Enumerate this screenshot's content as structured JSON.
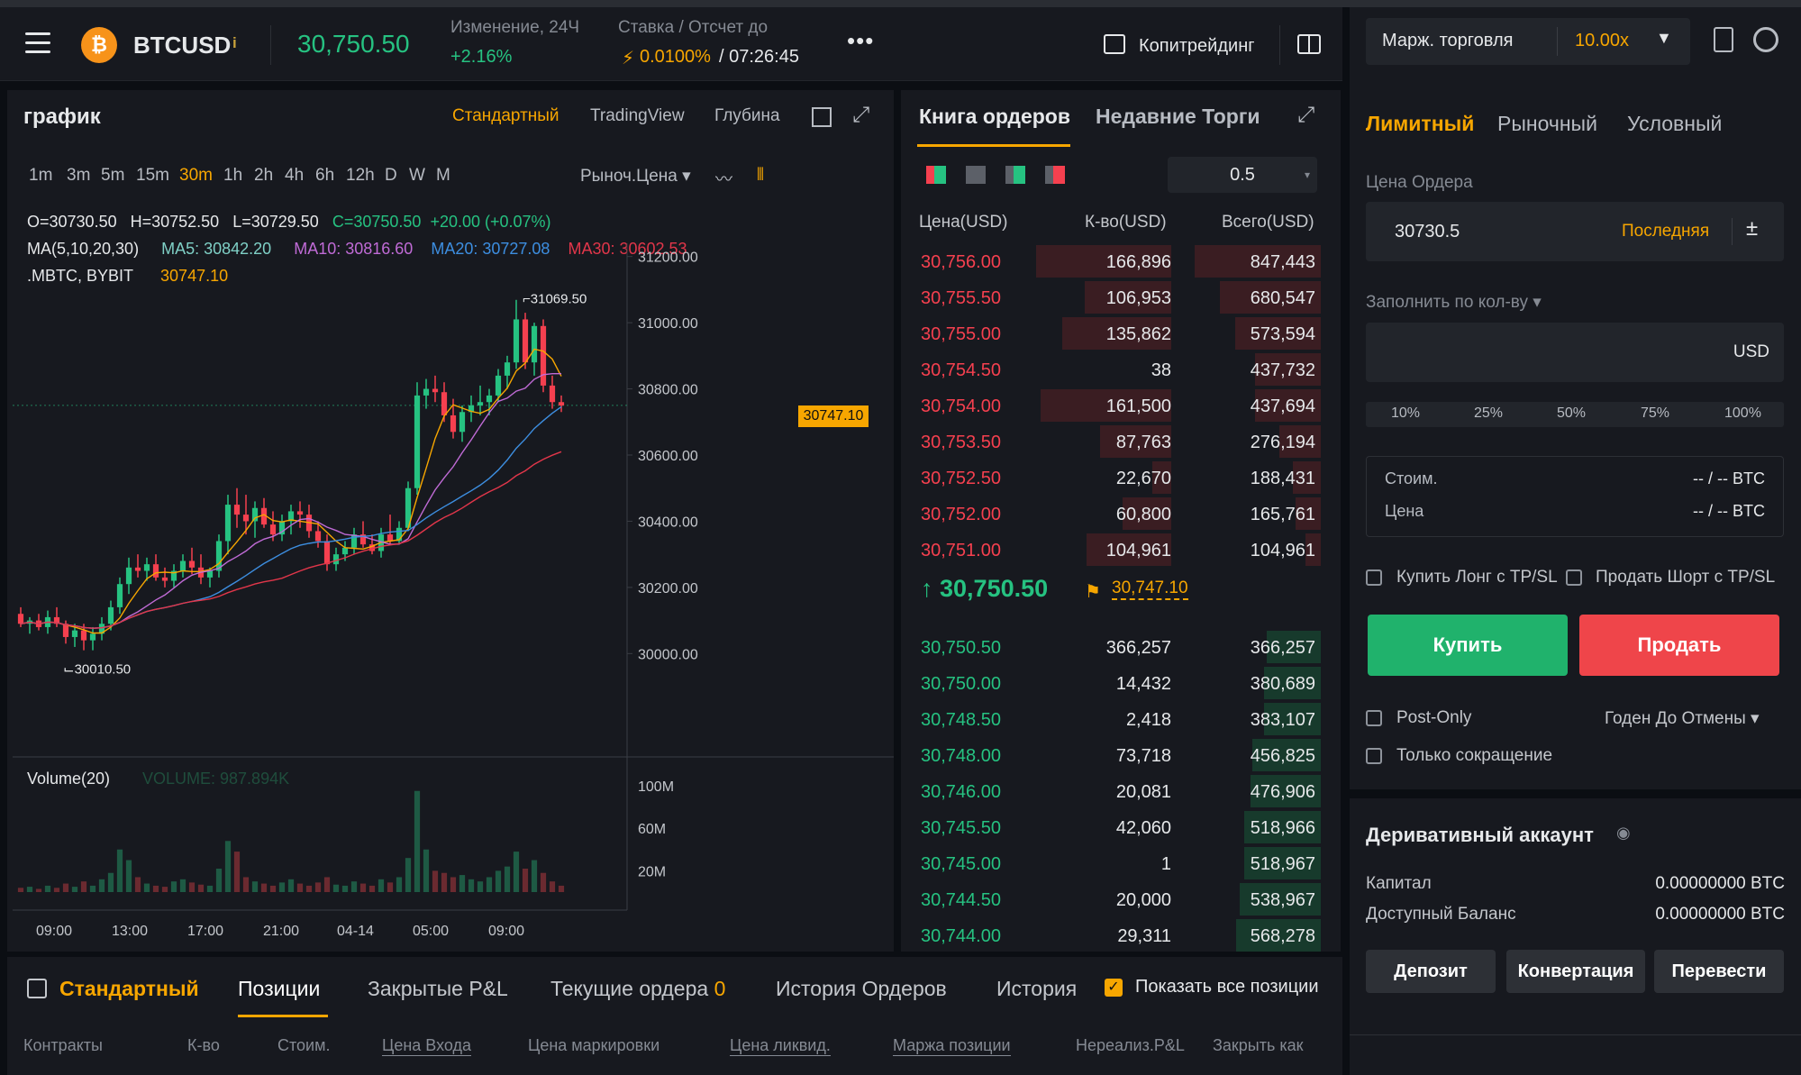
{
  "header": {
    "symbol": "BTCUSD",
    "coin_glyph": "₿",
    "price": "30,750.50",
    "change_label": "Изменение, 24Ч",
    "change_value": "+2.16%",
    "funding_label": "Ставка / Отсчет до",
    "funding_rate": "0.0100%",
    "funding_countdown": "/ 07:26:45",
    "more": "•••",
    "copytrading": "Копитрейдинг"
  },
  "chart": {
    "title": "график",
    "modes": [
      "Стандартный",
      "TradingView",
      "Глубина"
    ],
    "timeframes": [
      "1m",
      "3m",
      "5m",
      "15m",
      "30m",
      "1h",
      "2h",
      "4h",
      "6h",
      "12h",
      "D",
      "W",
      "M"
    ],
    "active_timeframe": "30m",
    "price_type": "Рыноч.Цена ▾",
    "ohlc": {
      "o": "O=30730.50",
      "h": "H=30752.50",
      "l": "L=30729.50",
      "c": "C=30750.50",
      "chg": "+20.00 (+0.07%)"
    },
    "ma": {
      "label": "MA(5,10,20,30)",
      "ma5": "MA5: 30842.20",
      "ma10": "MA10: 30816.60",
      "ma20": "MA20: 30727.08",
      "ma30": "MA30: 30602.53"
    },
    "mark": {
      "label": ".MBTC,  BYBIT",
      "value": "30747.10"
    },
    "high_annot": "31069.50",
    "low_annot": "30010.50",
    "price_tag": "30747.10",
    "volume_label": "Volume(20)",
    "volume_value": "VOLUME: 987.894K",
    "volume_ticks": [
      "100M",
      "60M",
      "20M"
    ],
    "x_ticks": [
      "09:00",
      "13:00",
      "17:00",
      "21:00",
      "04-14",
      "05:00",
      "09:00"
    ]
  },
  "chart_data": {
    "type": "candlestick",
    "y_ticks": [
      31200,
      31000,
      30800,
      30600,
      30400,
      30200,
      30000
    ],
    "ylim": [
      29960,
      31240
    ],
    "candles": [
      [
        30120,
        30140,
        30080,
        30090
      ],
      [
        30090,
        30110,
        30060,
        30100
      ],
      [
        30100,
        30120,
        30070,
        30080
      ],
      [
        30080,
        30130,
        30060,
        30110
      ],
      [
        30110,
        30140,
        30080,
        30090
      ],
      [
        30090,
        30100,
        30030,
        30050
      ],
      [
        30050,
        30090,
        30020,
        30070
      ],
      [
        30070,
        30090,
        30010,
        30040
      ],
      [
        30040,
        30080,
        30010,
        30060
      ],
      [
        30060,
        30110,
        30040,
        30090
      ],
      [
        30090,
        30160,
        30070,
        30140
      ],
      [
        30140,
        30230,
        30120,
        30210
      ],
      [
        30210,
        30290,
        30180,
        30260
      ],
      [
        30260,
        30300,
        30230,
        30250
      ],
      [
        30250,
        30290,
        30220,
        30270
      ],
      [
        30270,
        30300,
        30220,
        30230
      ],
      [
        30230,
        30260,
        30200,
        30220
      ],
      [
        30220,
        30270,
        30200,
        30250
      ],
      [
        30250,
        30300,
        30230,
        30280
      ],
      [
        30280,
        30320,
        30240,
        30260
      ],
      [
        30260,
        30300,
        30210,
        30230
      ],
      [
        30230,
        30260,
        30200,
        30250
      ],
      [
        30250,
        30360,
        30230,
        30340
      ],
      [
        30340,
        30480,
        30300,
        30450
      ],
      [
        30450,
        30500,
        30380,
        30420
      ],
      [
        30420,
        30480,
        30360,
        30400
      ],
      [
        30400,
        30460,
        30350,
        30440
      ],
      [
        30440,
        30470,
        30380,
        30390
      ],
      [
        30390,
        30430,
        30340,
        30360
      ],
      [
        30360,
        30420,
        30340,
        30400
      ],
      [
        30400,
        30450,
        30360,
        30430
      ],
      [
        30430,
        30460,
        30380,
        30420
      ],
      [
        30420,
        30450,
        30350,
        30370
      ],
      [
        30370,
        30400,
        30320,
        30340
      ],
      [
        30340,
        30360,
        30250,
        30270
      ],
      [
        30270,
        30320,
        30250,
        30300
      ],
      [
        30300,
        30340,
        30280,
        30320
      ],
      [
        30320,
        30380,
        30300,
        30360
      ],
      [
        30360,
        30400,
        30320,
        30330
      ],
      [
        30330,
        30360,
        30300,
        30310
      ],
      [
        30310,
        30380,
        30290,
        30360
      ],
      [
        30360,
        30420,
        30330,
        30340
      ],
      [
        30340,
        30400,
        30330,
        30380
      ],
      [
        30380,
        30520,
        30370,
        30500
      ],
      [
        30500,
        30820,
        30480,
        30780
      ],
      [
        30780,
        30830,
        30740,
        30800
      ],
      [
        30800,
        30840,
        30760,
        30790
      ],
      [
        30790,
        30820,
        30700,
        30720
      ],
      [
        30720,
        30770,
        30650,
        30670
      ],
      [
        30670,
        30750,
        30640,
        30730
      ],
      [
        30730,
        30780,
        30700,
        30750
      ],
      [
        30750,
        30810,
        30720,
        30760
      ],
      [
        30760,
        30800,
        30720,
        30780
      ],
      [
        30780,
        30860,
        30760,
        30840
      ],
      [
        30840,
        30900,
        30800,
        30880
      ],
      [
        30880,
        31069,
        30860,
        31010
      ],
      [
        31010,
        31030,
        30860,
        30880
      ],
      [
        30880,
        31000,
        30840,
        30990
      ],
      [
        30990,
        31010,
        30790,
        30810
      ],
      [
        30810,
        30840,
        30740,
        30760
      ],
      [
        30760,
        30780,
        30730,
        30750
      ]
    ],
    "volumes": [
      4,
      5,
      3,
      6,
      4,
      8,
      5,
      10,
      6,
      12,
      18,
      40,
      30,
      14,
      8,
      6,
      5,
      10,
      12,
      9,
      7,
      6,
      22,
      48,
      38,
      14,
      10,
      8,
      6,
      9,
      12,
      8,
      6,
      9,
      14,
      7,
      6,
      10,
      8,
      6,
      12,
      9,
      14,
      32,
      95,
      40,
      20,
      18,
      14,
      16,
      12,
      10,
      14,
      20,
      24,
      38,
      22,
      30,
      18,
      10,
      6
    ],
    "vol_ticks": [
      100,
      60,
      20
    ]
  },
  "orderbook": {
    "tabs": [
      "Книга ордеров",
      "Недавние Торги"
    ],
    "grouping": "0.5",
    "headers": [
      "Цена(USD)",
      "К-во(USD)",
      "Всего(USD)"
    ],
    "asks": [
      {
        "p": "30,756.00",
        "q": "166,896",
        "t": "847,443",
        "qf": 1.0,
        "tf": 1.0
      },
      {
        "p": "30,755.50",
        "q": "106,953",
        "t": "680,547",
        "qf": 0.64,
        "tf": 0.8
      },
      {
        "p": "30,755.00",
        "q": "135,862",
        "t": "573,594",
        "qf": 0.81,
        "tf": 0.68
      },
      {
        "p": "30,754.50",
        "q": "38",
        "t": "437,732",
        "qf": 0.0,
        "tf": 0.52
      },
      {
        "p": "30,754.00",
        "q": "161,500",
        "t": "437,694",
        "qf": 0.97,
        "tf": 0.52
      },
      {
        "p": "30,753.50",
        "q": "87,763",
        "t": "276,194",
        "qf": 0.53,
        "tf": 0.33
      },
      {
        "p": "30,752.50",
        "q": "22,670",
        "t": "188,431",
        "qf": 0.14,
        "tf": 0.22
      },
      {
        "p": "30,752.00",
        "q": "60,800",
        "t": "165,761",
        "qf": 0.36,
        "tf": 0.2
      },
      {
        "p": "30,751.00",
        "q": "104,961",
        "t": "104,961",
        "qf": 0.63,
        "tf": 0.12
      }
    ],
    "mid_price": "30,750.50",
    "mid_mark": "30,747.10",
    "bids": [
      {
        "p": "30,750.50",
        "q": "366,257",
        "t": "366,257",
        "tf": 0.43
      },
      {
        "p": "30,750.00",
        "q": "14,432",
        "t": "380,689",
        "tf": 0.45
      },
      {
        "p": "30,748.50",
        "q": "2,418",
        "t": "383,107",
        "tf": 0.45
      },
      {
        "p": "30,748.00",
        "q": "73,718",
        "t": "456,825",
        "tf": 0.54
      },
      {
        "p": "30,746.00",
        "q": "20,081",
        "t": "476,906",
        "tf": 0.56
      },
      {
        "p": "30,745.50",
        "q": "42,060",
        "t": "518,966",
        "tf": 0.61
      },
      {
        "p": "30,745.00",
        "q": "1",
        "t": "518,967",
        "tf": 0.61
      },
      {
        "p": "30,744.50",
        "q": "20,000",
        "t": "538,967",
        "tf": 0.64
      },
      {
        "p": "30,744.00",
        "q": "29,311",
        "t": "568,278",
        "tf": 0.67
      }
    ]
  },
  "trade": {
    "margin_mode": "Марж. торговля",
    "leverage": "10.00x",
    "tabs": [
      "Лимитный",
      "Рыночный",
      "Условный"
    ],
    "order_price_label": "Цена Ордера",
    "order_price": "30730.5",
    "last_label": "Последняя",
    "qty_label": "Заполнить по кол-ву ▾",
    "qty_unit": "USD",
    "pcts": [
      "10%",
      "25%",
      "50%",
      "75%",
      "100%"
    ],
    "cost_label": "Стоим.",
    "price_label": "Цена",
    "cost_val": "-- / -- BTC",
    "price_val": "-- / -- BTC",
    "long_tpsl": "Купить Лонг с TP/SL",
    "short_tpsl": "Продать Шорт с TP/SL",
    "buy": "Купить",
    "sell": "Продать",
    "post_only": "Post-Only",
    "tif": "Годен До Отмены ▾",
    "reduce_only": "Только сокращение",
    "account_title": "Деривативный аккаунт",
    "capital_label": "Капитал",
    "capital_val": "0.00000000 BTC",
    "avail_label": "Доступный Баланс",
    "avail_val": "0.00000000 BTC",
    "deposit": "Депозит",
    "convert": "Конвертация",
    "transfer": "Перевести"
  },
  "bottom": {
    "tabs": [
      "Стандартный",
      "Позиции",
      "Закрытые P&L",
      "Текущие ордера",
      "История Ордеров",
      "История"
    ],
    "open_orders_count": "0",
    "show_all": "Показать все позиции",
    "columns": [
      "Контракты",
      "К-во",
      "Стоим.",
      "Цена Входа",
      "Цена маркировки",
      "Цена ликвид.",
      "Маржа позиции",
      "Нереализ.P&L",
      "Закрыть как"
    ]
  },
  "colors": {
    "up": "#26c281",
    "down": "#f5404f",
    "accent": "#f7a600",
    "ma5": "#f7a600",
    "ma10": "#c06bd6",
    "ma20": "#3d8ee0",
    "ma30": "#e2364a"
  }
}
